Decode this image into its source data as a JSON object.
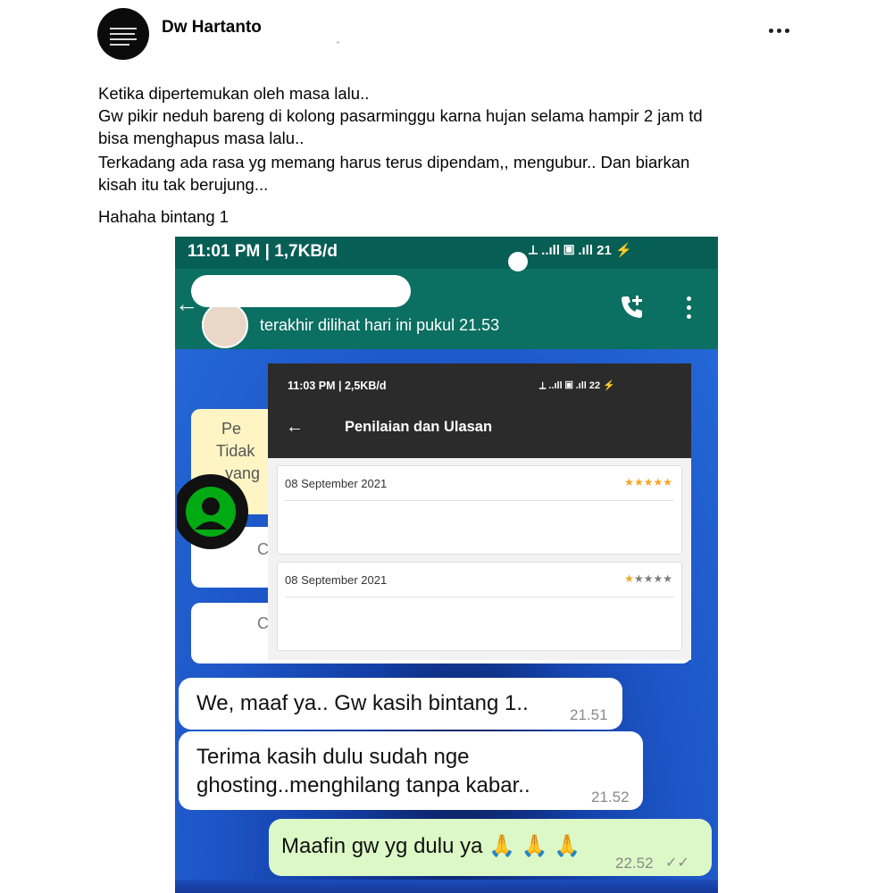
{
  "post": {
    "author": "Dw Hartanto",
    "lines": [
      "Ketika dipertemukan oleh masa lalu..",
      "Gw pikir neduh bareng di kolong pasarminggu karna hujan selama hampir 2 jam td",
      "bisa menghapus masa lalu..",
      "Terkadang ada rasa yg memang harus terus dipendam,, mengubur.. Dan biarkan",
      "kisah itu tak berujung...",
      "Hahaha bintang 1"
    ],
    "more_icon": "more-horizontal-icon"
  },
  "whatsapp": {
    "status_time": "11:01 PM | 1,7KB/d",
    "status_icons": "⟂ ..ıll ▣ .ıll 21 ⚡",
    "battery": "21",
    "last_seen": "terakhir dilihat hari ini pukul 21.53",
    "encrypted_snippet": [
      "Pe",
      "Tidak",
      "yang"
    ],
    "partial_bubble_letters": [
      "C",
      "C"
    ],
    "partial_tail": "...",
    "messages": [
      {
        "text": [
          "We, maaf ya.. Gw kasih bintang 1.."
        ],
        "time": "21.51",
        "outgoing": false
      },
      {
        "text": [
          "Terima kasih dulu sudah nge",
          "ghosting..menghilang tanpa kabar.."
        ],
        "time": "21.52",
        "outgoing": false
      },
      {
        "text": [
          "Maafin gw yg dulu ya 🙏 🙏 🙏"
        ],
        "time": "22.52",
        "outgoing": true,
        "read_ticks": "✓✓"
      }
    ],
    "colors": {
      "header": "#0b6f62",
      "outgoing_bubble": "#dcf8c6",
      "incoming_bubble": "#ffffff"
    }
  },
  "overlay": {
    "status_time": "11:03 PM | 2,5KB/d",
    "status_icons": "⟂ ..ıll ▣ .ıll 22 ⚡",
    "title": "Penilaian dan Ulasan",
    "reviews": [
      {
        "date": "08 September 2021",
        "rating": 5,
        "max": 5
      },
      {
        "date": "08 September 2021",
        "rating": 1,
        "max": 5
      }
    ],
    "colors": {
      "bar": "#2b2b2b",
      "star_on": "#f5a623",
      "star_off": "#7d7d7d"
    }
  }
}
